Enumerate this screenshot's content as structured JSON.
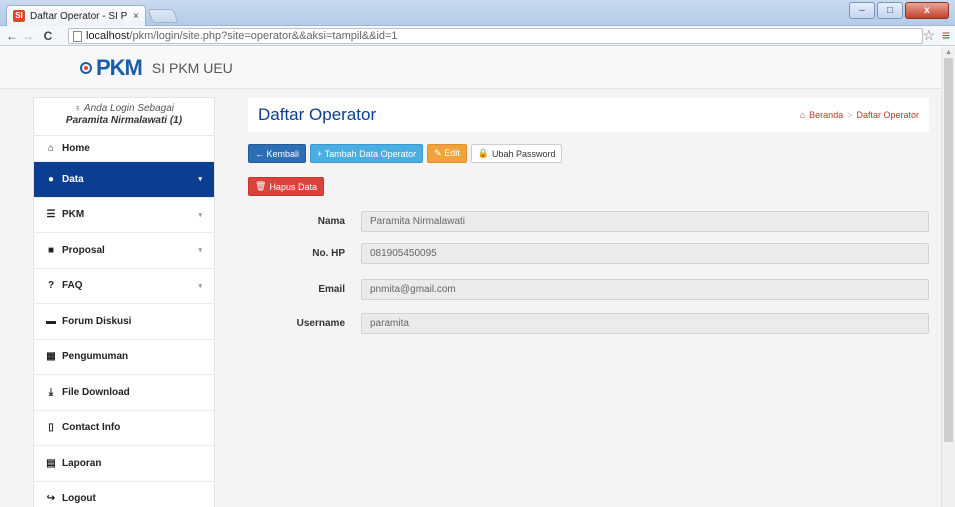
{
  "browser": {
    "tab_title": "Daftar Operator - SI PKM",
    "tab_close": "×",
    "favicon": "SI",
    "url_host": "localhost",
    "url_path": "/pkm/login/site.php?site=operator&&aksi=tampil&&id=1",
    "back_icon": "←",
    "forward_icon": "→",
    "reload_icon": "C",
    "star_icon": "☆",
    "menu_icon": "≡",
    "win_min": "–",
    "win_max": "□",
    "win_close": "x"
  },
  "header": {
    "logo_text": "PKM",
    "brand": "SI PKM UEU"
  },
  "sidebar": {
    "login_label": "Anda Login Sebagai",
    "user_name": "Paramita Nirmalawati (1)",
    "items": [
      {
        "label": "Home",
        "icon": "home-icon",
        "glyph": "⌂"
      },
      {
        "label": "Data",
        "icon": "user-icon",
        "glyph": "●",
        "active": true,
        "caret": "▾"
      },
      {
        "label": "PKM",
        "icon": "list-icon",
        "glyph": "☰",
        "caret": "▾"
      },
      {
        "label": "Proposal",
        "icon": "book-icon",
        "glyph": "■",
        "caret": "▾"
      },
      {
        "label": "FAQ",
        "icon": "question-icon",
        "glyph": "?",
        "caret": "▾"
      },
      {
        "label": "Forum Diskusi",
        "icon": "comment-icon",
        "glyph": "▬"
      },
      {
        "label": "Pengumuman",
        "icon": "grid-icon",
        "glyph": "▦"
      },
      {
        "label": "File Download",
        "icon": "download-icon",
        "glyph": "⤓"
      },
      {
        "label": "Contact Info",
        "icon": "phone-icon",
        "glyph": "▯"
      },
      {
        "label": "Laporan",
        "icon": "report-icon",
        "glyph": "▤"
      },
      {
        "label": "Logout",
        "icon": "logout-icon",
        "glyph": "↪"
      }
    ]
  },
  "main": {
    "title": "Daftar Operator",
    "breadcrumb": [
      "Beranda",
      "Daftar Operator"
    ],
    "buttons": {
      "kembali": "← Kembali",
      "tambah": "+ Tambah Data Operator",
      "edit": "✎ Edit",
      "ubah_password": "Ubah Password",
      "hapus": "Hapus Data"
    },
    "fields": [
      {
        "label": "Nama",
        "value": "Paramita Nirmalawati"
      },
      {
        "label": "No. HP",
        "value": "081905450095"
      },
      {
        "label": "Email",
        "value": "pnmita@gmail.com"
      },
      {
        "label": "Username",
        "value": "paramita"
      }
    ]
  },
  "colors": {
    "primary": "#0b3d91",
    "btn_blue": "#2e6fb4",
    "btn_cyan": "#4aaee0",
    "btn_orange": "#f0a33a",
    "btn_red": "#d9433b",
    "breadcrumb": "#c0392b"
  }
}
